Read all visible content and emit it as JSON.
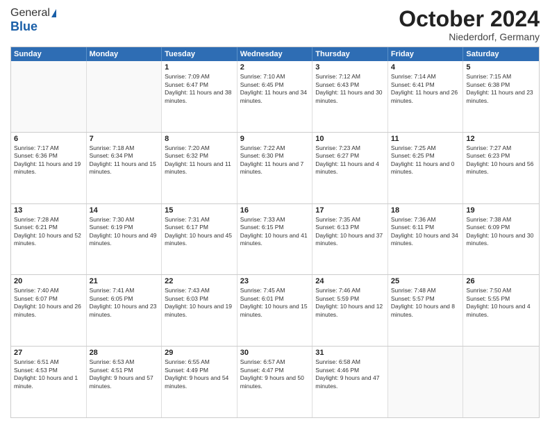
{
  "logo": {
    "line1": "General",
    "line2": "Blue"
  },
  "header": {
    "month": "October 2024",
    "location": "Niederdorf, Germany"
  },
  "weekdays": [
    "Sunday",
    "Monday",
    "Tuesday",
    "Wednesday",
    "Thursday",
    "Friday",
    "Saturday"
  ],
  "weeks": [
    [
      {
        "day": "",
        "sunrise": "",
        "sunset": "",
        "daylight": ""
      },
      {
        "day": "",
        "sunrise": "",
        "sunset": "",
        "daylight": ""
      },
      {
        "day": "1",
        "sunrise": "Sunrise: 7:09 AM",
        "sunset": "Sunset: 6:47 PM",
        "daylight": "Daylight: 11 hours and 38 minutes."
      },
      {
        "day": "2",
        "sunrise": "Sunrise: 7:10 AM",
        "sunset": "Sunset: 6:45 PM",
        "daylight": "Daylight: 11 hours and 34 minutes."
      },
      {
        "day": "3",
        "sunrise": "Sunrise: 7:12 AM",
        "sunset": "Sunset: 6:43 PM",
        "daylight": "Daylight: 11 hours and 30 minutes."
      },
      {
        "day": "4",
        "sunrise": "Sunrise: 7:14 AM",
        "sunset": "Sunset: 6:41 PM",
        "daylight": "Daylight: 11 hours and 26 minutes."
      },
      {
        "day": "5",
        "sunrise": "Sunrise: 7:15 AM",
        "sunset": "Sunset: 6:38 PM",
        "daylight": "Daylight: 11 hours and 23 minutes."
      }
    ],
    [
      {
        "day": "6",
        "sunrise": "Sunrise: 7:17 AM",
        "sunset": "Sunset: 6:36 PM",
        "daylight": "Daylight: 11 hours and 19 minutes."
      },
      {
        "day": "7",
        "sunrise": "Sunrise: 7:18 AM",
        "sunset": "Sunset: 6:34 PM",
        "daylight": "Daylight: 11 hours and 15 minutes."
      },
      {
        "day": "8",
        "sunrise": "Sunrise: 7:20 AM",
        "sunset": "Sunset: 6:32 PM",
        "daylight": "Daylight: 11 hours and 11 minutes."
      },
      {
        "day": "9",
        "sunrise": "Sunrise: 7:22 AM",
        "sunset": "Sunset: 6:30 PM",
        "daylight": "Daylight: 11 hours and 7 minutes."
      },
      {
        "day": "10",
        "sunrise": "Sunrise: 7:23 AM",
        "sunset": "Sunset: 6:27 PM",
        "daylight": "Daylight: 11 hours and 4 minutes."
      },
      {
        "day": "11",
        "sunrise": "Sunrise: 7:25 AM",
        "sunset": "Sunset: 6:25 PM",
        "daylight": "Daylight: 11 hours and 0 minutes."
      },
      {
        "day": "12",
        "sunrise": "Sunrise: 7:27 AM",
        "sunset": "Sunset: 6:23 PM",
        "daylight": "Daylight: 10 hours and 56 minutes."
      }
    ],
    [
      {
        "day": "13",
        "sunrise": "Sunrise: 7:28 AM",
        "sunset": "Sunset: 6:21 PM",
        "daylight": "Daylight: 10 hours and 52 minutes."
      },
      {
        "day": "14",
        "sunrise": "Sunrise: 7:30 AM",
        "sunset": "Sunset: 6:19 PM",
        "daylight": "Daylight: 10 hours and 49 minutes."
      },
      {
        "day": "15",
        "sunrise": "Sunrise: 7:31 AM",
        "sunset": "Sunset: 6:17 PM",
        "daylight": "Daylight: 10 hours and 45 minutes."
      },
      {
        "day": "16",
        "sunrise": "Sunrise: 7:33 AM",
        "sunset": "Sunset: 6:15 PM",
        "daylight": "Daylight: 10 hours and 41 minutes."
      },
      {
        "day": "17",
        "sunrise": "Sunrise: 7:35 AM",
        "sunset": "Sunset: 6:13 PM",
        "daylight": "Daylight: 10 hours and 37 minutes."
      },
      {
        "day": "18",
        "sunrise": "Sunrise: 7:36 AM",
        "sunset": "Sunset: 6:11 PM",
        "daylight": "Daylight: 10 hours and 34 minutes."
      },
      {
        "day": "19",
        "sunrise": "Sunrise: 7:38 AM",
        "sunset": "Sunset: 6:09 PM",
        "daylight": "Daylight: 10 hours and 30 minutes."
      }
    ],
    [
      {
        "day": "20",
        "sunrise": "Sunrise: 7:40 AM",
        "sunset": "Sunset: 6:07 PM",
        "daylight": "Daylight: 10 hours and 26 minutes."
      },
      {
        "day": "21",
        "sunrise": "Sunrise: 7:41 AM",
        "sunset": "Sunset: 6:05 PM",
        "daylight": "Daylight: 10 hours and 23 minutes."
      },
      {
        "day": "22",
        "sunrise": "Sunrise: 7:43 AM",
        "sunset": "Sunset: 6:03 PM",
        "daylight": "Daylight: 10 hours and 19 minutes."
      },
      {
        "day": "23",
        "sunrise": "Sunrise: 7:45 AM",
        "sunset": "Sunset: 6:01 PM",
        "daylight": "Daylight: 10 hours and 15 minutes."
      },
      {
        "day": "24",
        "sunrise": "Sunrise: 7:46 AM",
        "sunset": "Sunset: 5:59 PM",
        "daylight": "Daylight: 10 hours and 12 minutes."
      },
      {
        "day": "25",
        "sunrise": "Sunrise: 7:48 AM",
        "sunset": "Sunset: 5:57 PM",
        "daylight": "Daylight: 10 hours and 8 minutes."
      },
      {
        "day": "26",
        "sunrise": "Sunrise: 7:50 AM",
        "sunset": "Sunset: 5:55 PM",
        "daylight": "Daylight: 10 hours and 4 minutes."
      }
    ],
    [
      {
        "day": "27",
        "sunrise": "Sunrise: 6:51 AM",
        "sunset": "Sunset: 4:53 PM",
        "daylight": "Daylight: 10 hours and 1 minute."
      },
      {
        "day": "28",
        "sunrise": "Sunrise: 6:53 AM",
        "sunset": "Sunset: 4:51 PM",
        "daylight": "Daylight: 9 hours and 57 minutes."
      },
      {
        "day": "29",
        "sunrise": "Sunrise: 6:55 AM",
        "sunset": "Sunset: 4:49 PM",
        "daylight": "Daylight: 9 hours and 54 minutes."
      },
      {
        "day": "30",
        "sunrise": "Sunrise: 6:57 AM",
        "sunset": "Sunset: 4:47 PM",
        "daylight": "Daylight: 9 hours and 50 minutes."
      },
      {
        "day": "31",
        "sunrise": "Sunrise: 6:58 AM",
        "sunset": "Sunset: 4:46 PM",
        "daylight": "Daylight: 9 hours and 47 minutes."
      },
      {
        "day": "",
        "sunrise": "",
        "sunset": "",
        "daylight": ""
      },
      {
        "day": "",
        "sunrise": "",
        "sunset": "",
        "daylight": ""
      }
    ]
  ]
}
